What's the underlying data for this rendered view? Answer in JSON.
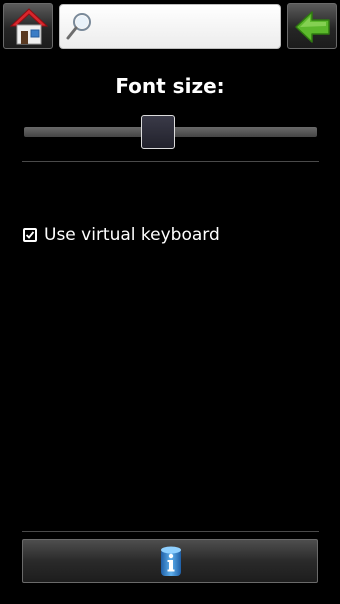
{
  "header": {
    "search": {
      "value": "",
      "placeholder": ""
    }
  },
  "settings": {
    "font_size_label": "Font size:",
    "font_size_level": 0.45,
    "virtual_keyboard": {
      "label": "Use virtual keyboard",
      "checked": true
    }
  },
  "icons": {
    "home": "home-icon",
    "search": "magnifier-icon",
    "back": "green-left-arrow-icon",
    "info": "info-icon"
  },
  "colors": {
    "background": "#000000",
    "text": "#ffffff",
    "home_roof": "#d8262c",
    "back_arrow": "#5cb82c",
    "info_blue": "#3b8ed6"
  }
}
